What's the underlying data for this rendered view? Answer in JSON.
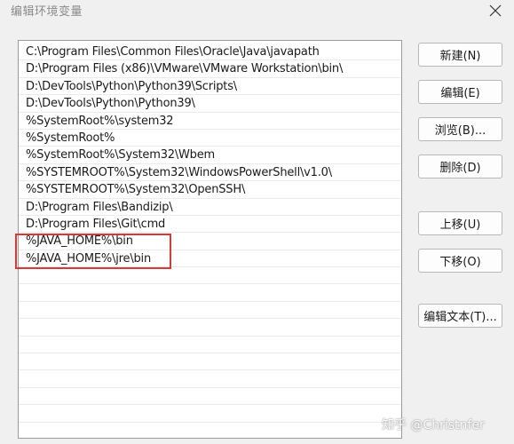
{
  "window": {
    "title": "编辑环境变量"
  },
  "path_list": {
    "entries": [
      "C:\\Program Files\\Common Files\\Oracle\\Java\\javapath",
      "D:\\Program Files (x86)\\VMware\\VMware Workstation\\bin\\",
      "D:\\DevTools\\Python\\Python39\\Scripts\\",
      "D:\\DevTools\\Python\\Python39\\",
      "%SystemRoot%\\system32",
      "%SystemRoot%",
      "%SystemRoot%\\System32\\Wbem",
      "%SYSTEMROOT%\\System32\\WindowsPowerShell\\v1.0\\",
      "%SYSTEMROOT%\\System32\\OpenSSH\\",
      "D:\\Program Files\\Bandizip\\",
      "D:\\Program Files\\Git\\cmd",
      "%JAVA_HOME%\\bin",
      "%JAVA_HOME%\\jre\\bin"
    ]
  },
  "buttons": {
    "new": "新建(N)",
    "edit": "编辑(E)",
    "browse": "浏览(B)...",
    "delete": "删除(D)",
    "move_up": "上移(U)",
    "move_down": "下移(O)",
    "edit_text": "编辑文本(T)..."
  },
  "watermark": {
    "text": "知乎 @Christnfer"
  },
  "colors": {
    "highlight_border": "#d6393a"
  }
}
